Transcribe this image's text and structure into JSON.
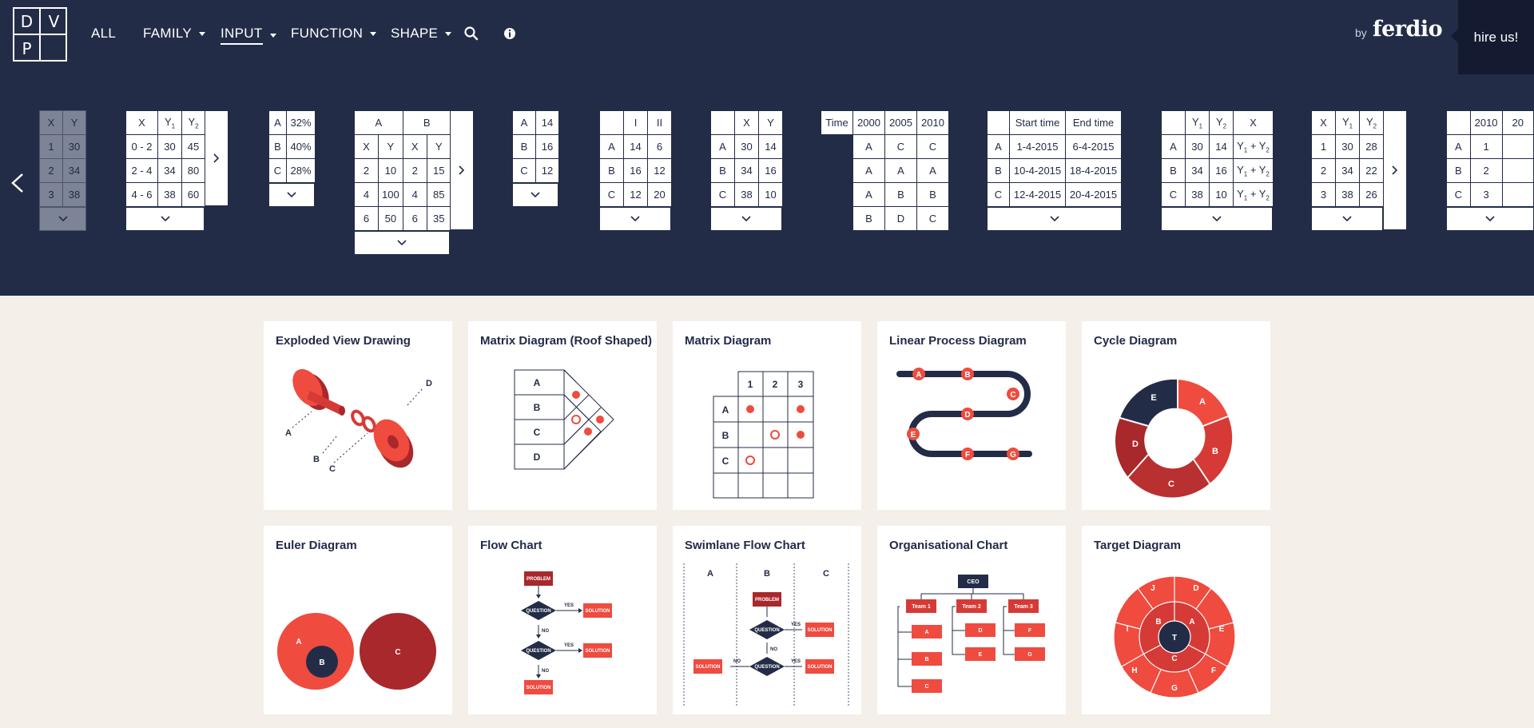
{
  "logo": {
    "letters": [
      "D",
      "V",
      "P"
    ]
  },
  "nav": {
    "items": [
      {
        "label": "ALL",
        "caret": false,
        "active": false
      },
      {
        "label": "FAMILY",
        "caret": true,
        "active": false
      },
      {
        "label": "INPUT",
        "caret": true,
        "active": true
      },
      {
        "label": "FUNCTION",
        "caret": true,
        "active": false
      },
      {
        "label": "SHAPE",
        "caret": true,
        "active": false
      }
    ],
    "search_icon": "search-icon",
    "info_icon": "info-icon",
    "by_label": "by",
    "brand": "ferdio",
    "hire_label": "hire us!"
  },
  "input_tables": [
    {
      "name": "xy",
      "rows": [
        [
          "X",
          "Y"
        ],
        [
          "1",
          "30"
        ],
        [
          "2",
          "34"
        ],
        [
          "3",
          "38"
        ]
      ],
      "dim": true
    },
    {
      "name": "ranges",
      "rows": [
        [
          "X",
          "Y1",
          "Y2"
        ],
        [
          "0 - 2",
          "30",
          "45"
        ],
        [
          "2 - 4",
          "34",
          "80"
        ],
        [
          "4 - 6",
          "38",
          "60"
        ]
      ],
      "side": true
    },
    {
      "name": "percent",
      "rows": [
        [
          "A",
          "32%"
        ],
        [
          "B",
          "40%"
        ],
        [
          "C",
          "28%"
        ]
      ]
    },
    {
      "name": "paired",
      "header": [
        "A",
        "B"
      ],
      "rows": [
        [
          "X",
          "Y",
          "X",
          "Y"
        ],
        [
          "2",
          "10",
          "2",
          "15"
        ],
        [
          "4",
          "100",
          "4",
          "85"
        ],
        [
          "6",
          "50",
          "6",
          "35"
        ]
      ],
      "side": true
    },
    {
      "name": "values",
      "rows": [
        [
          "A",
          "14"
        ],
        [
          "B",
          "16"
        ],
        [
          "C",
          "12"
        ]
      ]
    },
    {
      "name": "roman",
      "rows": [
        [
          "",
          "I",
          "II"
        ],
        [
          "A",
          "14",
          "6"
        ],
        [
          "B",
          "16",
          "12"
        ],
        [
          "C",
          "12",
          "20"
        ]
      ]
    },
    {
      "name": "xy-labels",
      "rows": [
        [
          "",
          "X",
          "Y"
        ],
        [
          "A",
          "30",
          "14"
        ],
        [
          "B",
          "34",
          "16"
        ],
        [
          "C",
          "38",
          "10"
        ]
      ]
    },
    {
      "name": "time",
      "rows": [
        [
          "Time",
          "2000",
          "2005",
          "2010"
        ],
        [
          "",
          "A",
          "C",
          "C"
        ],
        [
          "",
          "A",
          "A",
          "A"
        ],
        [
          "",
          "A",
          "B",
          "B"
        ],
        [
          "",
          "B",
          "D",
          "C"
        ]
      ]
    },
    {
      "name": "dates",
      "rows": [
        [
          "",
          "Start time",
          "End time"
        ],
        [
          "A",
          "1-4-2015",
          "6-4-2015"
        ],
        [
          "B",
          "10-4-2015",
          "18-4-2015"
        ],
        [
          "C",
          "12-4-2015",
          "20-4-2015"
        ]
      ]
    },
    {
      "name": "y1y2x",
      "rows": [
        [
          "",
          "Y1",
          "Y2",
          "X"
        ],
        [
          "A",
          "30",
          "14",
          "Y1 + Y2"
        ],
        [
          "B",
          "34",
          "16",
          "Y1 + Y2"
        ],
        [
          "C",
          "38",
          "10",
          "Y1 + Y2"
        ]
      ]
    },
    {
      "name": "x-y1-y2",
      "rows": [
        [
          "X",
          "Y1",
          "Y2"
        ],
        [
          "1",
          "30",
          "28"
        ],
        [
          "2",
          "34",
          "22"
        ],
        [
          "3",
          "38",
          "26"
        ]
      ],
      "side": true
    },
    {
      "name": "years",
      "rows": [
        [
          "",
          "2010",
          "20"
        ],
        [
          "A",
          "1",
          ""
        ],
        [
          "B",
          "2",
          ""
        ],
        [
          "C",
          "3",
          ""
        ]
      ]
    }
  ],
  "cards": [
    {
      "title": "Exploded View Drawing",
      "labels": [
        "A",
        "B",
        "C",
        "D"
      ]
    },
    {
      "title": "Matrix Diagram (Roof Shaped)",
      "labels": [
        "A",
        "B",
        "C",
        "D"
      ]
    },
    {
      "title": "Matrix Diagram",
      "labels": [
        "1",
        "2",
        "3",
        "A",
        "B",
        "C"
      ]
    },
    {
      "title": "Linear Process Diagram",
      "labels": [
        "A",
        "B",
        "C",
        "D",
        "E",
        "F",
        "G"
      ]
    },
    {
      "title": "Cycle Diagram",
      "labels": [
        "A",
        "B",
        "C",
        "D",
        "E"
      ]
    },
    {
      "title": "Euler Diagram",
      "labels": [
        "A",
        "B",
        "C"
      ]
    },
    {
      "title": "Flow Chart",
      "labels": [
        "PROBLEM",
        "QUESTION",
        "YES",
        "SOLUTION",
        "NO",
        "QUESTION",
        "YES",
        "SOLUTION",
        "NO",
        "SOLUTION"
      ]
    },
    {
      "title": "Swimlane Flow Chart",
      "labels": [
        "A",
        "B",
        "C",
        "PROBLEM",
        "QUESTION",
        "YES",
        "SOLUTION",
        "NO",
        "QUESTION",
        "YES",
        "SOLUTION",
        "NO",
        "SOLUTION"
      ]
    },
    {
      "title": "Organisational Chart",
      "labels": [
        "CEO",
        "Team 1",
        "Team 2",
        "Team 3",
        "A",
        "B",
        "C",
        "D",
        "E",
        "F",
        "G"
      ]
    },
    {
      "title": "Target Diagram",
      "labels": [
        "T",
        "A",
        "B",
        "C",
        "D",
        "E",
        "F",
        "G",
        "H",
        "I",
        "J"
      ]
    }
  ],
  "colors": {
    "navy": "#232c47",
    "red": "#ef4b3f",
    "red_mid": "#d63a36",
    "red_dark": "#a8282c",
    "cream": "#f4efe9"
  }
}
